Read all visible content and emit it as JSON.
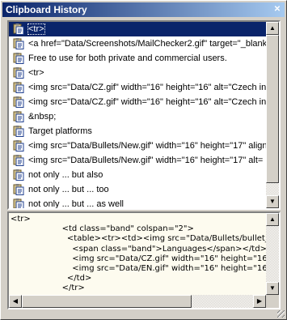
{
  "window": {
    "title": "Clipboard History",
    "close_glyph": "✕"
  },
  "history": {
    "items": [
      {
        "text": "<tr>",
        "selected": true
      },
      {
        "text": "<a href=\"Data/Screenshots/MailChecker2.gif\" target=\"_blank\"",
        "selected": false
      },
      {
        "text": "Free to use for both private and commercial users.",
        "selected": false
      },
      {
        "text": "<tr>",
        "selected": false
      },
      {
        "text": "<img src=\"Data/CZ.gif\" width=\"16\" height=\"16\" alt=\"Czech in",
        "selected": false
      },
      {
        "text": "<img src=\"Data/CZ.gif\" width=\"16\" height=\"16\" alt=\"Czech in",
        "selected": false
      },
      {
        "text": "&nbsp;",
        "selected": false
      },
      {
        "text": "Target platforms",
        "selected": false
      },
      {
        "text": "<img src=\"Data/Bullets/New.gif\" width=\"16\" height=\"17\" align",
        "selected": false
      },
      {
        "text": "<img src=\"Data/Bullets/New.gif\" width=\"16\" height=\"17\" alt=",
        "selected": false
      },
      {
        "text": "not only ... but also",
        "selected": false
      },
      {
        "text": "not only ... but ... too",
        "selected": false
      },
      {
        "text": "not only ... but ... as well",
        "selected": false
      }
    ],
    "icon": "clipboard-page-icon"
  },
  "preview": {
    "lines": [
      "<tr>",
      "                    <td class=\"band\" colspan=\"2\">",
      "                      <table><tr><td><img src=\"Data/Bullets/bullet_blue",
      "                        <span class=\"band\">Languages</span></td></t",
      "                        <img src=\"Data/CZ.gif\" width=\"16\" height=\"16\" a",
      "                        <img src=\"Data/EN.gif\" width=\"16\" height=\"16\" a",
      "                      </td>",
      "                    </tr>"
    ]
  },
  "scroll_glyphs": {
    "up": "▲",
    "down": "▼",
    "left": "◀",
    "right": "▶"
  }
}
